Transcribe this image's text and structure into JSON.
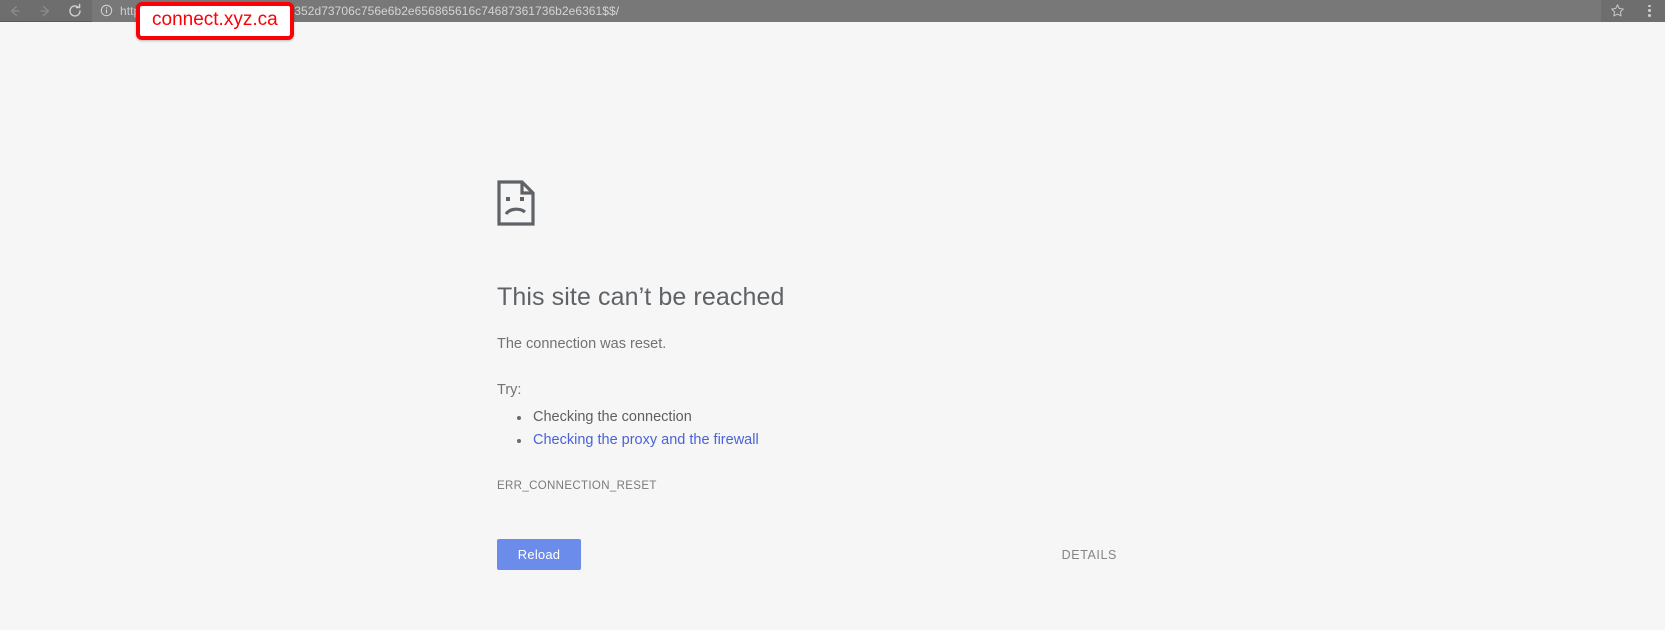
{
  "browser": {
    "nav": {
      "back_label": "Back",
      "forward_label": "Forward",
      "reload_label": "Reload page"
    },
    "omnibox": {
      "scheme": "https:",
      "rest": "/f5-w-68747470733a2f2f66352d73706c756e6b2e656865616c74687361736b2e6361$$/",
      "info_tooltip": "View site information"
    },
    "bookmark_label": "Bookmark this page",
    "menu_label": "Customize and control"
  },
  "annotation": {
    "callout_text": "connect.xyz.ca",
    "border_color": "#fb0007",
    "text_color": "#fb0007"
  },
  "error_page": {
    "icon_name": "sad-page-icon",
    "headline": "This site can’t be reached",
    "subtext": "The connection was reset.",
    "try_label": "Try:",
    "suggestions": [
      {
        "text": "Checking the connection",
        "is_link": false
      },
      {
        "text": "Checking the proxy and the firewall",
        "is_link": true
      }
    ],
    "error_code": "ERR_CONNECTION_RESET",
    "reload_button": "Reload",
    "details_button": "DETAILS",
    "accent_color": "#6c8ceb",
    "link_color": "#4a62d8",
    "background_color": "#f6f6f6"
  }
}
